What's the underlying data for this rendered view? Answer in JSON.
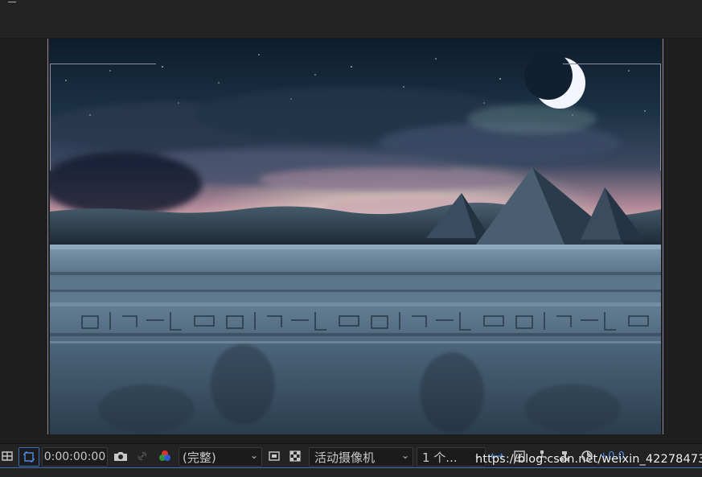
{
  "toolbar": {
    "timecode": "0:00:00:00",
    "resolution": "(完整)",
    "camera": "活动摄像机",
    "views": "1 个...",
    "exposure": "+0.0"
  },
  "icons": {
    "grid": "grid-icon",
    "region": "region-of-interest-icon",
    "snapshot": "camera-icon",
    "show_snapshot": "link-icon",
    "channels": "color-channels-icon",
    "fast_preview": "fast-preview-icon",
    "transparency": "transparency-grid-icon",
    "reset_exposure": "reset-exposure-icon"
  },
  "watermark": "https://blog.csdn.net/weixin_42278473",
  "colors": {
    "accent": "#3d6fb8",
    "panel": "#232323"
  }
}
